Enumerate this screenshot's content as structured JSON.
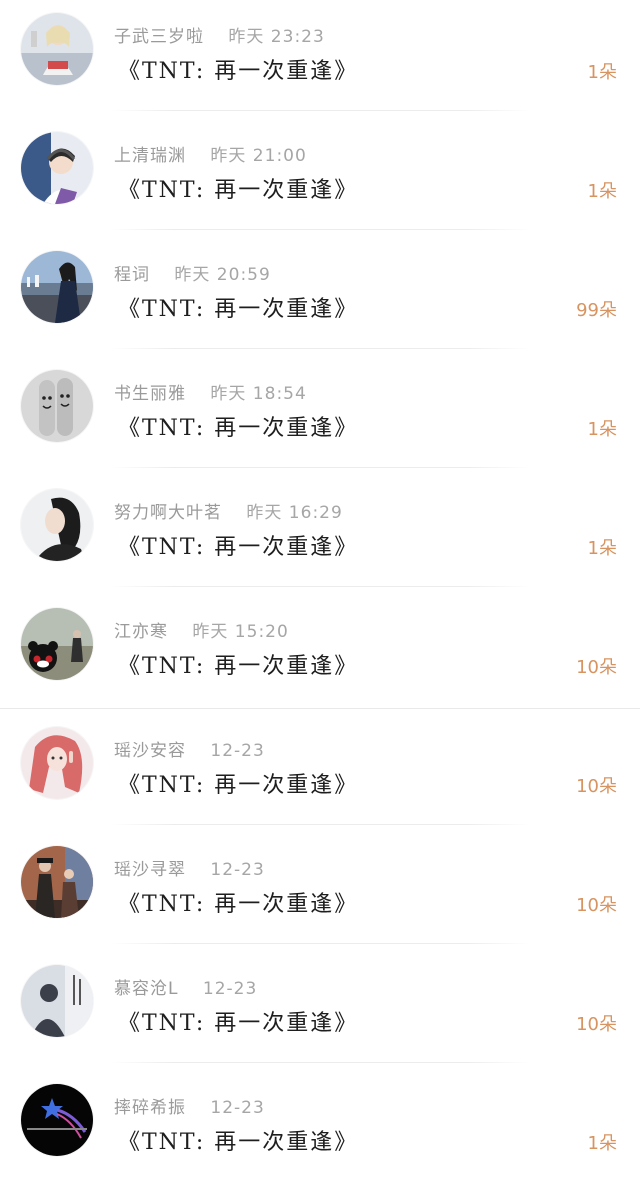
{
  "list": {
    "items": [
      {
        "name": "子武三岁啦",
        "time": "昨天 23:23",
        "title": "《TNT: 再一次重逢》",
        "count": "1朵",
        "avatar_icon": "avatar-girl-sitting"
      },
      {
        "name": "上清瑞渊",
        "time": "昨天 21:00",
        "title": "《TNT: 再一次重逢》",
        "count": "1朵",
        "avatar_icon": "avatar-boy-headphones"
      },
      {
        "name": "程词",
        "time": "昨天 20:59",
        "title": "《TNT: 再一次重逢》",
        "count": "99朵",
        "avatar_icon": "avatar-man-harbor"
      },
      {
        "name": "书生丽雅",
        "time": "昨天 18:54",
        "title": "《TNT: 再一次重逢》",
        "count": "1朵",
        "avatar_icon": "avatar-finger-faces"
      },
      {
        "name": "努力啊大叶茗",
        "time": "昨天 16:29",
        "title": "《TNT: 再一次重逢》",
        "count": "1朵",
        "avatar_icon": "avatar-woman-profile"
      },
      {
        "name": "江亦寒",
        "time": "昨天 15:20",
        "title": "《TNT: 再一次重逢》",
        "count": "10朵",
        "avatar_icon": "avatar-kumamon-bear"
      },
      {
        "name": "瑶沙安容",
        "time": "12-23",
        "title": "《TNT: 再一次重逢》",
        "count": "10朵",
        "avatar_icon": "avatar-red-hair-girl"
      },
      {
        "name": "瑶沙寻翠",
        "time": "12-23",
        "title": "《TNT: 再一次重逢》",
        "count": "10朵",
        "avatar_icon": "avatar-couple-street"
      },
      {
        "name": "慕容沧L",
        "time": "12-23",
        "title": "《TNT: 再一次重逢》",
        "count": "10朵",
        "avatar_icon": "avatar-shadow-silhouette"
      },
      {
        "name": "摔碎希振",
        "time": "12-23",
        "title": "《TNT: 再一次重逢》",
        "count": "1朵",
        "avatar_icon": "avatar-shooting-star"
      }
    ]
  },
  "colors": {
    "count": "#d79461",
    "meta": "#9a9a9a",
    "title": "#1e1e1e"
  }
}
